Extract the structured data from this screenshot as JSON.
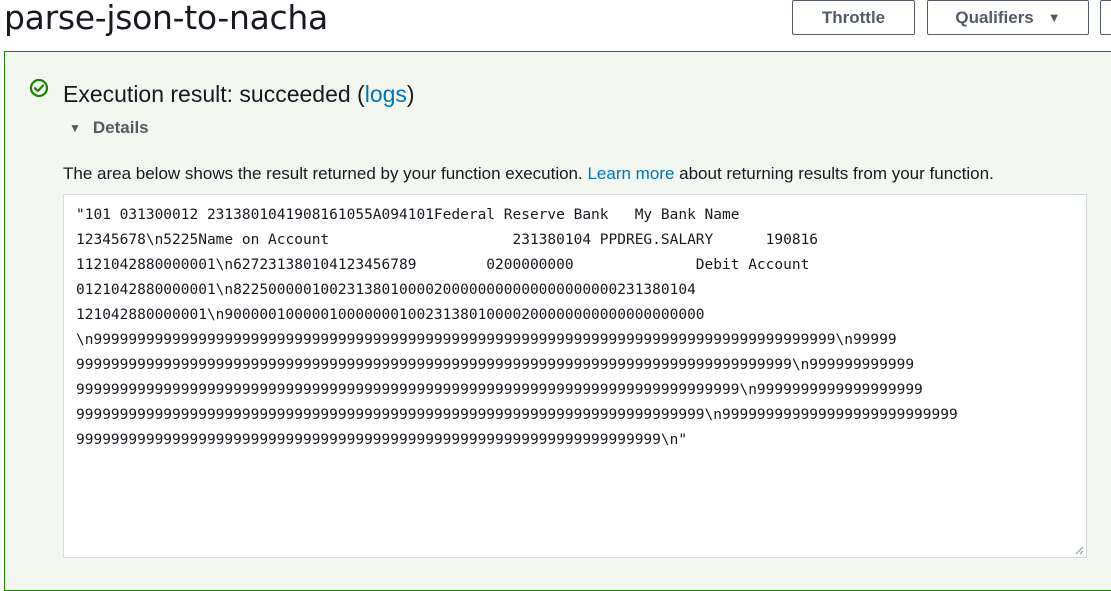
{
  "header": {
    "title": "parse-json-to-nacha",
    "throttle_label": "Throttle",
    "qualifiers_label": "Qualifiers"
  },
  "result": {
    "status_prefix": "Execution result: succeeded (",
    "logs_link": "logs",
    "status_suffix": ")",
    "details_label": "Details",
    "description_prefix": "The area below shows the result returned by your function execution. ",
    "learn_more_link": "Learn more",
    "description_suffix": " about returning results from your function.",
    "output_lines": [
      "\"101 031300012 2313801041908161055A094101Federal Reserve Bank   My Bank Name",
      "12345678\\n5225Name on Account                     231380104 PPDREG.SALARY      190816",
      "1121042880000001\\n627231380104123456789        0200000000              Debit Account",
      "0121042880000001\\n82250000010023138010000200000000000000000000231380104",
      "121042880000001\\n9000001000001000000010023138010000200000000000000000000",
      "\\n9999999999999999999999999999999999999999999999999999999999999999999999999999999999999\\n99999",
      "9999999999999999999999999999999999999999999999999999999999999999999999999999999999\\n999999999999",
      "9999999999999999999999999999999999999999999999999999999999999999999999999999\\n9999999999999999999",
      "999999999999999999999999999999999999999999999999999999999999999999999999\\n999999999999999999999999999",
      "9999999999999999999999999999999999999999999999999999999999999999999\\n\""
    ]
  },
  "colors": {
    "success": "#1d8102",
    "link": "#0073bb",
    "panel_bg": "#f2f8f0"
  },
  "icons": {
    "status": "check-circle-icon",
    "details": "caret-down-icon",
    "qualifiers": "caret-down-icon"
  }
}
